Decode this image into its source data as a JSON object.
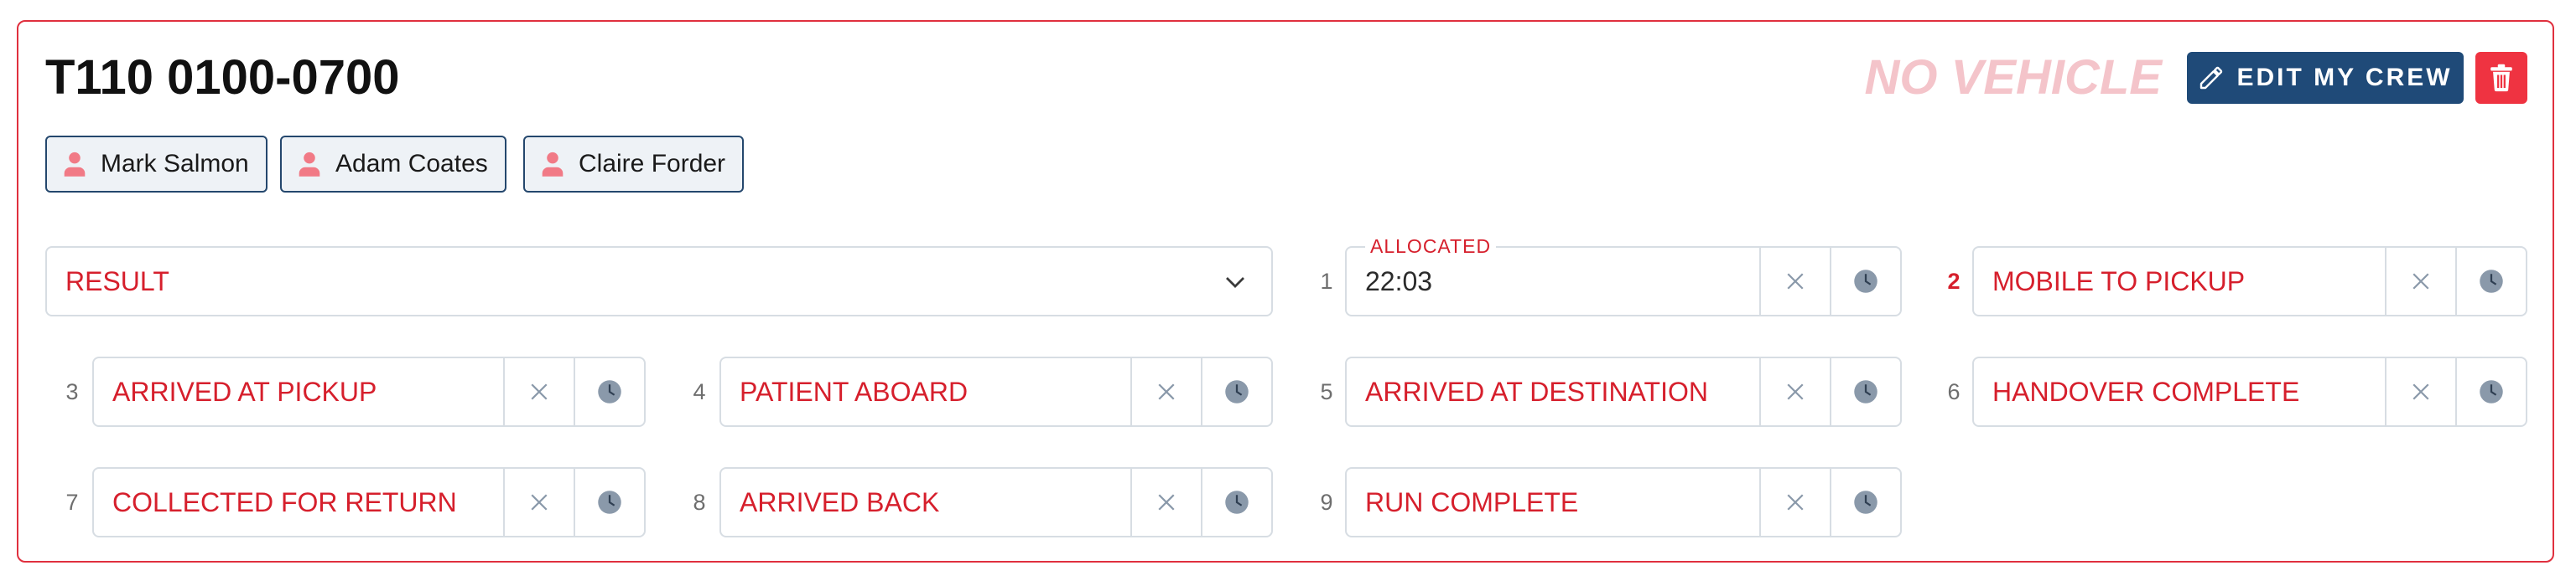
{
  "header": {
    "title": "T110 0100-0700",
    "vehicle_status": "NO VEHICLE",
    "edit_crew_label": "EDIT MY CREW"
  },
  "crew": [
    {
      "name": "Mark Salmon",
      "icon": "person-icon"
    },
    {
      "name": "Adam Coates",
      "icon": "person-icon"
    },
    {
      "name": "Claire Forder",
      "icon": "person-icon"
    }
  ],
  "result": {
    "value": "RESULT"
  },
  "steps": [
    {
      "number": "1",
      "label": "ALLOCATED",
      "value": "22:03"
    },
    {
      "number": "2",
      "label": "MOBILE TO PICKUP",
      "current": true
    },
    {
      "number": "3",
      "label": "ARRIVED AT PICKUP"
    },
    {
      "number": "4",
      "label": "PATIENT ABOARD"
    },
    {
      "number": "5",
      "label": "ARRIVED AT DESTINATION"
    },
    {
      "number": "6",
      "label": "HANDOVER COMPLETE"
    },
    {
      "number": "7",
      "label": "COLLECTED FOR RETURN"
    },
    {
      "number": "8",
      "label": "ARRIVED BACK"
    },
    {
      "number": "9",
      "label": "RUN COMPLETE"
    }
  ],
  "colors": {
    "accent_red": "#d61f2c",
    "navy": "#1f4a78",
    "delete_red": "#ef3341",
    "clock_grey": "#8a99aa"
  }
}
